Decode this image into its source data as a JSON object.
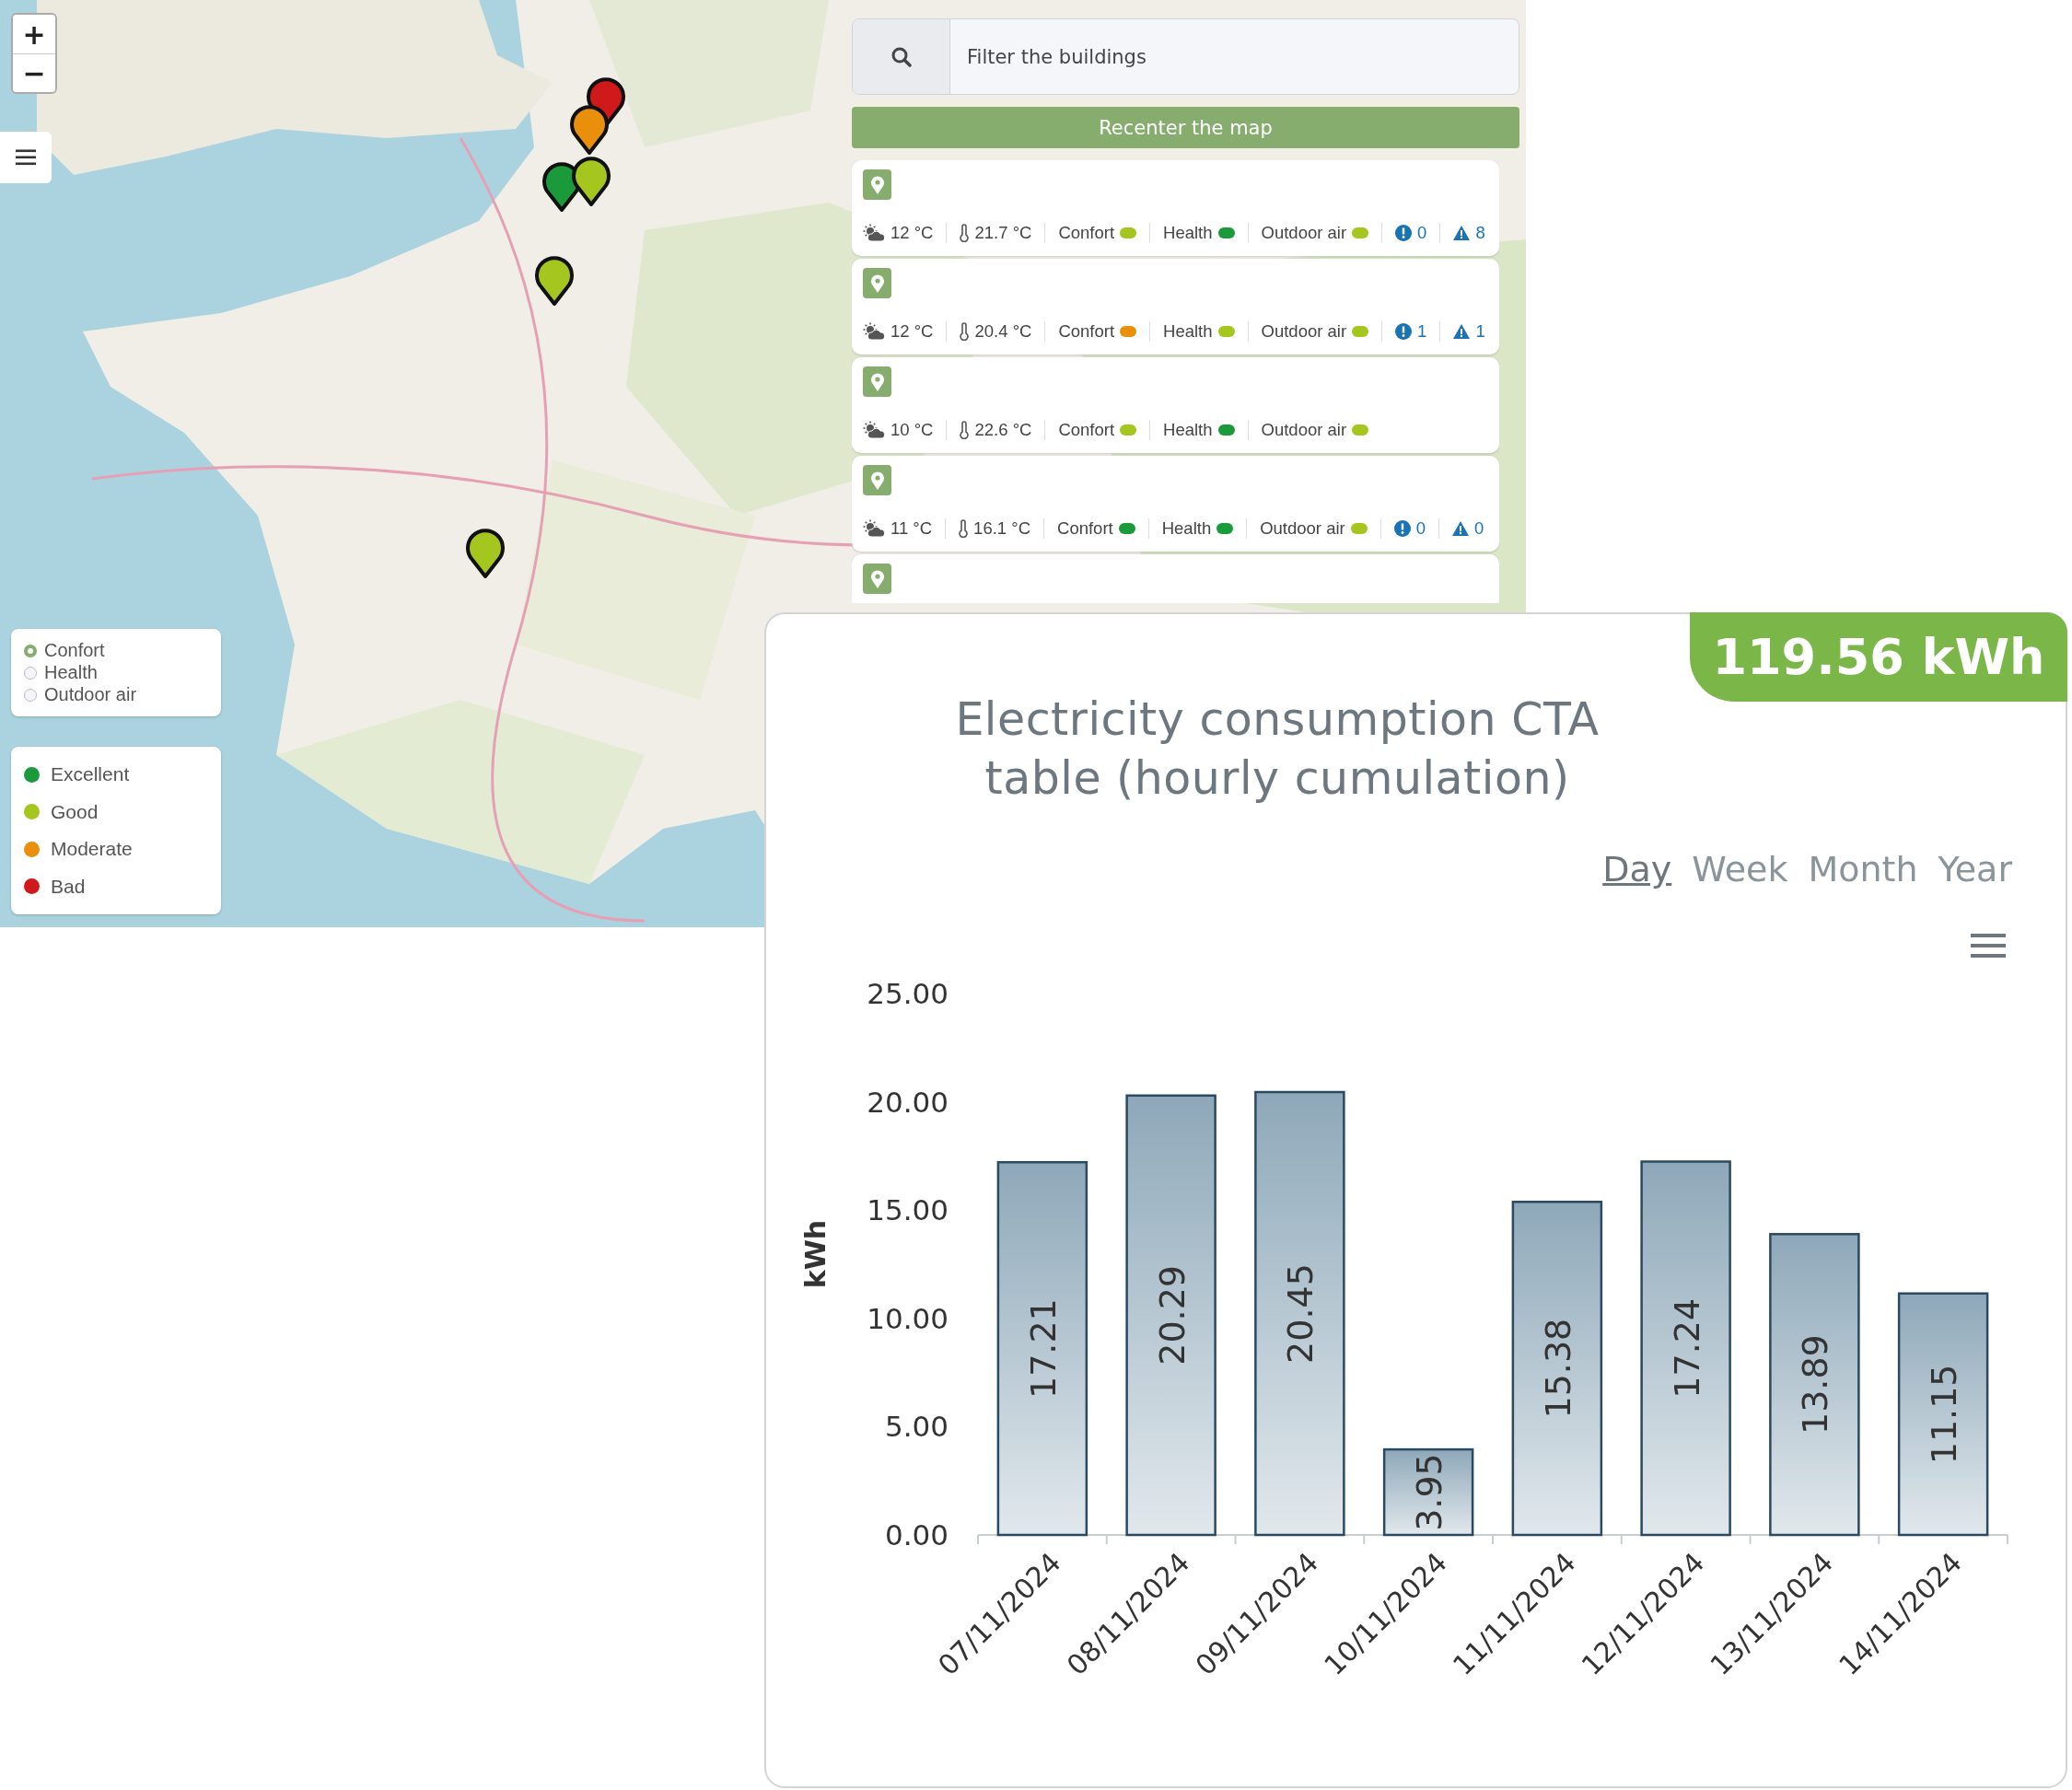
{
  "map": {
    "zoom_in": "+",
    "zoom_out": "−",
    "pins": [
      {
        "color": "#d0191b"
      },
      {
        "color": "#e8900c"
      },
      {
        "color": "#1a9a3a"
      },
      {
        "color": "#a5c61e"
      },
      {
        "color": "#a5c61e"
      },
      {
        "color": "#a5c61e"
      }
    ],
    "layer_options": [
      {
        "label": "Confort",
        "selected": true
      },
      {
        "label": "Health",
        "selected": false
      },
      {
        "label": "Outdoor air",
        "selected": false
      }
    ],
    "legend": [
      {
        "label": "Excellent",
        "color": "#1a9a3a"
      },
      {
        "label": "Good",
        "color": "#a5c61e"
      },
      {
        "label": "Moderate",
        "color": "#e8900c"
      },
      {
        "label": "Bad",
        "color": "#d0191b"
      }
    ]
  },
  "search": {
    "placeholder": "Filter the buildings"
  },
  "recenter_button": "Recenter the map",
  "buildings": [
    {
      "kind": "full",
      "outdoor_temp": "12 °C",
      "indoor_temp": "21.7 °C",
      "indicators": [
        {
          "label": "Confort",
          "color": "#a5c61e"
        },
        {
          "label": "Health",
          "color": "#1a9a3a"
        },
        {
          "label": "Outdoor air",
          "color": "#a5c61e"
        }
      ],
      "alerts": "0",
      "warnings": "8"
    },
    {
      "kind": "full",
      "outdoor_temp": "12 °C",
      "indoor_temp": "20.4 °C",
      "indicators": [
        {
          "label": "Confort",
          "color": "#e8900c"
        },
        {
          "label": "Health",
          "color": "#a5c61e"
        },
        {
          "label": "Outdoor air",
          "color": "#a5c61e"
        }
      ],
      "alerts": "1",
      "warnings": "1"
    },
    {
      "kind": "full",
      "outdoor_temp": "10 °C",
      "indoor_temp": "22.6 °C",
      "indicators": [
        {
          "label": "Confort",
          "color": "#a5c61e"
        },
        {
          "label": "Health",
          "color": "#1a9a3a"
        },
        {
          "label": "Outdoor air",
          "color": "#a5c61e"
        }
      ]
    },
    {
      "kind": "full",
      "outdoor_temp": "11 °C",
      "indoor_temp": "16.1 °C",
      "indicators": [
        {
          "label": "Confort",
          "color": "#1a9a3a"
        },
        {
          "label": "Health",
          "color": "#1a9a3a"
        },
        {
          "label": "Outdoor air",
          "color": "#a5c61e"
        }
      ],
      "alerts": "0",
      "warnings": "0"
    },
    {
      "kind": "cut"
    }
  ],
  "energy": {
    "total": "119.56 kWh",
    "periods": [
      {
        "label": "Day",
        "selected": true
      },
      {
        "label": "Week",
        "selected": false
      },
      {
        "label": "Month",
        "selected": false
      },
      {
        "label": "Year",
        "selected": false
      }
    ],
    "chart_data": {
      "type": "bar",
      "title": "Electricity consumption CTA table (hourly cumulation)",
      "ylabel": "kWh",
      "categories": [
        "07/11/2024",
        "08/11/2024",
        "09/11/2024",
        "10/11/2024",
        "11/11/2024",
        "12/11/2024",
        "13/11/2024",
        "14/11/2024"
      ],
      "values": [
        17.21,
        20.29,
        20.45,
        3.95,
        15.38,
        17.24,
        13.89,
        11.15
      ],
      "value_labels": [
        "17.21",
        "20.29",
        "20.45",
        "3.95",
        "15.38",
        "17.24",
        "13.89",
        "11.15"
      ],
      "ylim": [
        0,
        25
      ],
      "yticks": [
        {
          "value": 0,
          "label": "0.00"
        },
        {
          "value": 5,
          "label": "5.00"
        },
        {
          "value": 10,
          "label": "10.00"
        },
        {
          "value": 15,
          "label": "15.00"
        },
        {
          "value": 20,
          "label": "20.00"
        },
        {
          "value": 25,
          "label": "25.00"
        }
      ]
    }
  }
}
